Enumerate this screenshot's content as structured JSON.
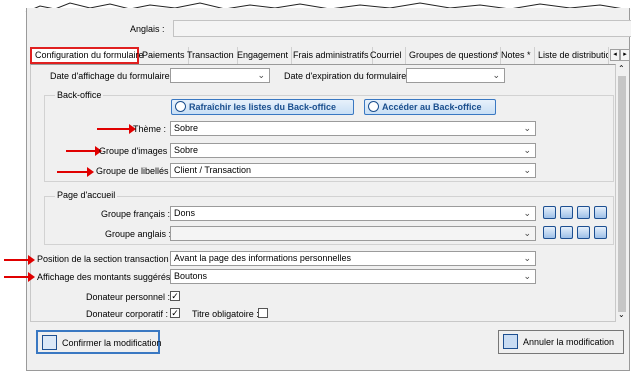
{
  "header": {
    "anglais_label": "Anglais :",
    "anglais_value": ""
  },
  "tabs": [
    {
      "label": "Configuration du formulaire",
      "active": true
    },
    {
      "label": "Paiements"
    },
    {
      "label": "Transaction"
    },
    {
      "label": "Engagement"
    },
    {
      "label": "Frais administratifs"
    },
    {
      "label": "Courriel"
    },
    {
      "label": "Groupes de questions"
    },
    {
      "label": "* Notes *"
    },
    {
      "label": "Liste de distributio"
    }
  ],
  "tab_scroll": {
    "left": "◂",
    "right": "▸"
  },
  "form": {
    "date_affichage_label": "Date d'affichage du formulaire :",
    "date_affichage_value": "",
    "date_expiration_label": "Date d'expiration du formulaire :",
    "date_expiration_value": ""
  },
  "backoffice": {
    "title": "Back-office",
    "refresh_button": "Rafraîchir les listes du Back-office",
    "access_button": "Accéder au Back-office",
    "theme_label": "Thème :",
    "theme_value": "Sobre",
    "groupe_images_label": "Groupe d'images :",
    "groupe_images_value": "Sobre",
    "groupe_libelles_label": "Groupe de libellés :",
    "groupe_libelles_value": "Client / Transaction"
  },
  "accueil": {
    "title": "Page d'accueil",
    "groupe_francais_label": "Groupe français :",
    "groupe_francais_value": "Dons",
    "groupe_anglais_label": "Groupe anglais :",
    "groupe_anglais_value": ""
  },
  "transaction": {
    "position_label": "Position de la section transaction :",
    "position_value": "Avant la page des informations personnelles",
    "affichage_label": "Affichage des montants suggérés :",
    "affichage_value": "Boutons",
    "donateur_personnel_label": "Donateur personnel :",
    "donateur_personnel_checked": true,
    "donateur_corporatif_label": "Donateur corporatif :",
    "donateur_corporatif_checked": true,
    "titre_obligatoire_label": "Titre obligatoire :",
    "titre_obligatoire_checked": false
  },
  "footer": {
    "confirm_button": "Confirmer la modification",
    "cancel_button": "Annuler la modification"
  },
  "colors": {
    "annotation_arrow": "#e00000",
    "active_tab_border": "#e02020",
    "accent_blue": "#3a78c2"
  }
}
